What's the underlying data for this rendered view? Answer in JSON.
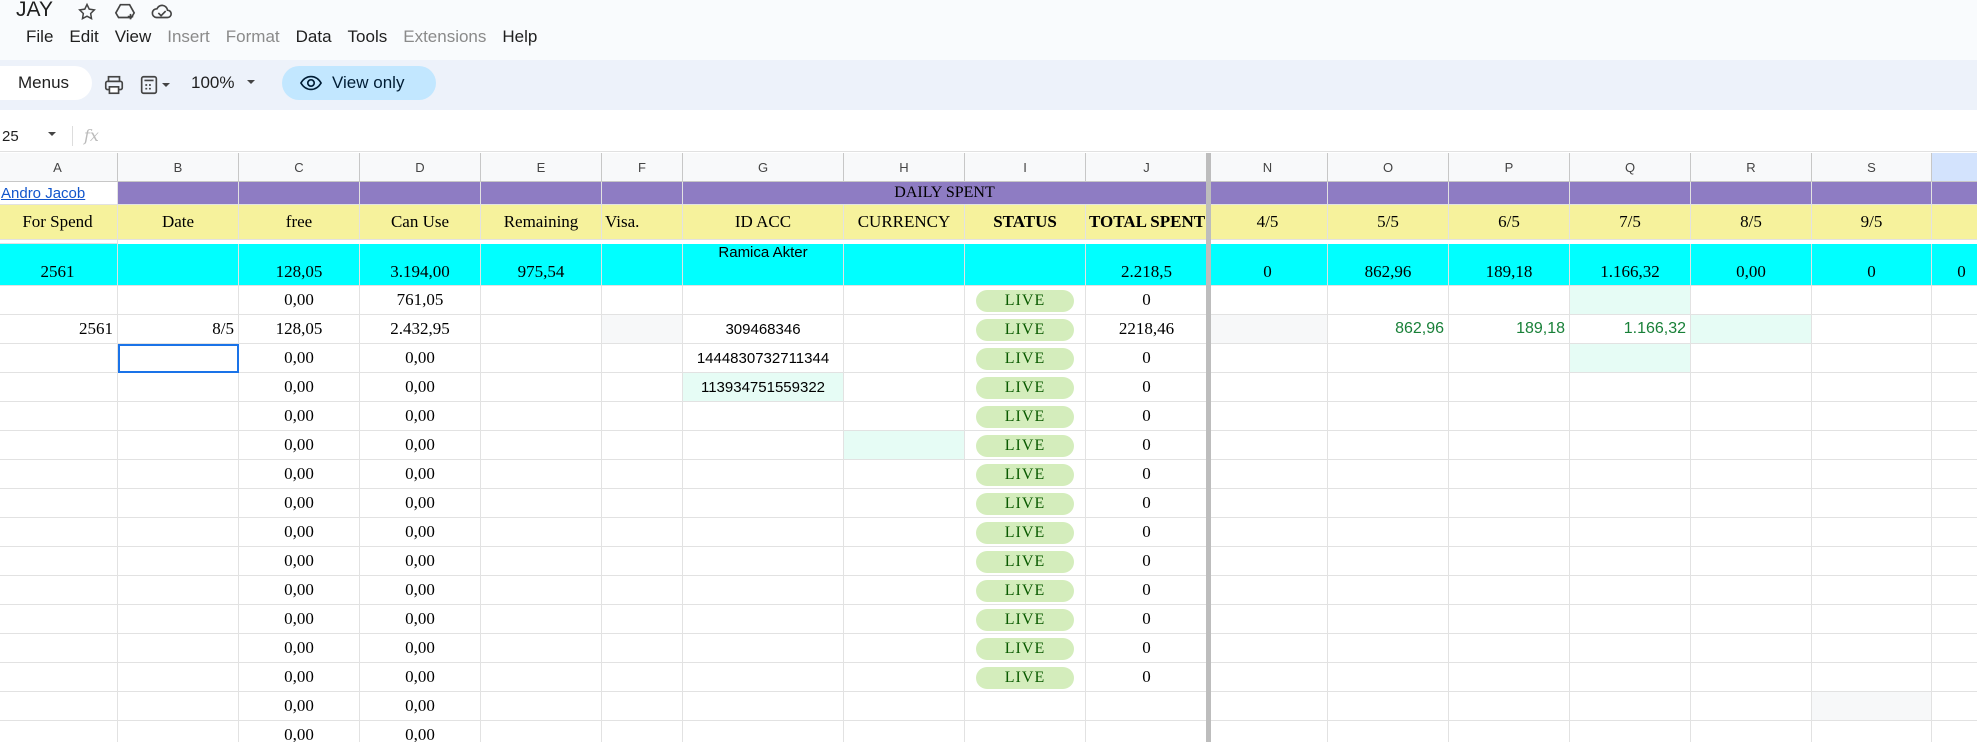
{
  "document": {
    "title": "JAY"
  },
  "menu": [
    "File",
    "Edit",
    "View",
    "Insert",
    "Format",
    "Data",
    "Tools",
    "Extensions",
    "Help"
  ],
  "menu_disabled": [
    "Insert",
    "Format",
    "Extensions"
  ],
  "toolbar": {
    "search_label": "Menus",
    "zoom": "100%",
    "view_only_label": "View only"
  },
  "formula_bar": {
    "name_box": "25",
    "fx_label": "fx"
  },
  "columns": [
    "A",
    "B",
    "C",
    "D",
    "E",
    "F",
    "G",
    "H",
    "I",
    "J",
    "N",
    "O",
    "P",
    "Q",
    "R",
    "S"
  ],
  "sheet": {
    "owner_link": "Andro Jacob",
    "banner": "DAILY SPENT",
    "headers": {
      "A": "For Spend",
      "B": "Date",
      "C": "free",
      "D": "Can Use",
      "E": "Remaining",
      "F": "Visa.",
      "G": "ID ACC",
      "H": "CURRENCY",
      "I": "STATUS",
      "J": "TOTAL SPENT",
      "N": "4/5",
      "O": "5/5",
      "P": "6/5",
      "Q": "7/5",
      "R": "8/5",
      "S": "9/5"
    },
    "summary": {
      "A": "2561",
      "C": "128,05",
      "D": "3.194,00",
      "E": "975,54",
      "G": "Ramica Akter",
      "J": "2.218,5",
      "N": "0",
      "O": "862,96",
      "P": "189,18",
      "Q": "1.166,32",
      "R": "0,00",
      "S": "0",
      "T": "0"
    },
    "rows": [
      {
        "A": "",
        "B": "",
        "C": "0,00",
        "D": "761,05",
        "G": "",
        "I": "LIVE",
        "J": "0",
        "O": "",
        "P": "",
        "Q": ""
      },
      {
        "A": "2561",
        "B": "8/5",
        "C": "128,05",
        "D": "2.432,95",
        "G": "309468346",
        "I": "LIVE",
        "J": "2218,46",
        "O": "862,96",
        "P": "189,18",
        "Q": "1.166,32"
      },
      {
        "A": "",
        "B": "",
        "C": "0,00",
        "D": "0,00",
        "G": "1444830732711344",
        "I": "LIVE",
        "J": "0"
      },
      {
        "A": "",
        "B": "",
        "C": "0,00",
        "D": "0,00",
        "G": "113934751559322",
        "I": "LIVE",
        "J": "0"
      },
      {
        "A": "",
        "B": "",
        "C": "0,00",
        "D": "0,00",
        "G": "",
        "I": "LIVE",
        "J": "0"
      },
      {
        "A": "",
        "B": "",
        "C": "0,00",
        "D": "0,00",
        "G": "",
        "I": "LIVE",
        "J": "0"
      },
      {
        "A": "",
        "B": "",
        "C": "0,00",
        "D": "0,00",
        "G": "",
        "I": "LIVE",
        "J": "0"
      },
      {
        "A": "",
        "B": "",
        "C": "0,00",
        "D": "0,00",
        "G": "",
        "I": "LIVE",
        "J": "0"
      },
      {
        "A": "",
        "B": "",
        "C": "0,00",
        "D": "0,00",
        "G": "",
        "I": "LIVE",
        "J": "0"
      },
      {
        "A": "",
        "B": "",
        "C": "0,00",
        "D": "0,00",
        "G": "",
        "I": "LIVE",
        "J": "0"
      },
      {
        "A": "",
        "B": "",
        "C": "0,00",
        "D": "0,00",
        "G": "",
        "I": "LIVE",
        "J": "0"
      },
      {
        "A": "",
        "B": "",
        "C": "0,00",
        "D": "0,00",
        "G": "",
        "I": "LIVE",
        "J": "0"
      },
      {
        "A": "",
        "B": "",
        "C": "0,00",
        "D": "0,00",
        "G": "",
        "I": "LIVE",
        "J": "0"
      },
      {
        "A": "",
        "B": "",
        "C": "0,00",
        "D": "0,00",
        "G": "",
        "I": "LIVE",
        "J": "0"
      },
      {
        "A": "",
        "B": "",
        "C": "0,00",
        "D": "0,00",
        "G": "",
        "I": "",
        "J": ""
      },
      {
        "A": "",
        "B": "",
        "C": "0,00",
        "D": "0,00",
        "G": "",
        "I": "",
        "J": ""
      }
    ]
  },
  "colors": {
    "banner": "#8e7cc3",
    "header_row": "#f6f29c",
    "summary_row": "#00ffff",
    "live_chip": "#d4edbc",
    "positive_text": "#188038",
    "selection": "#1a73e8"
  }
}
